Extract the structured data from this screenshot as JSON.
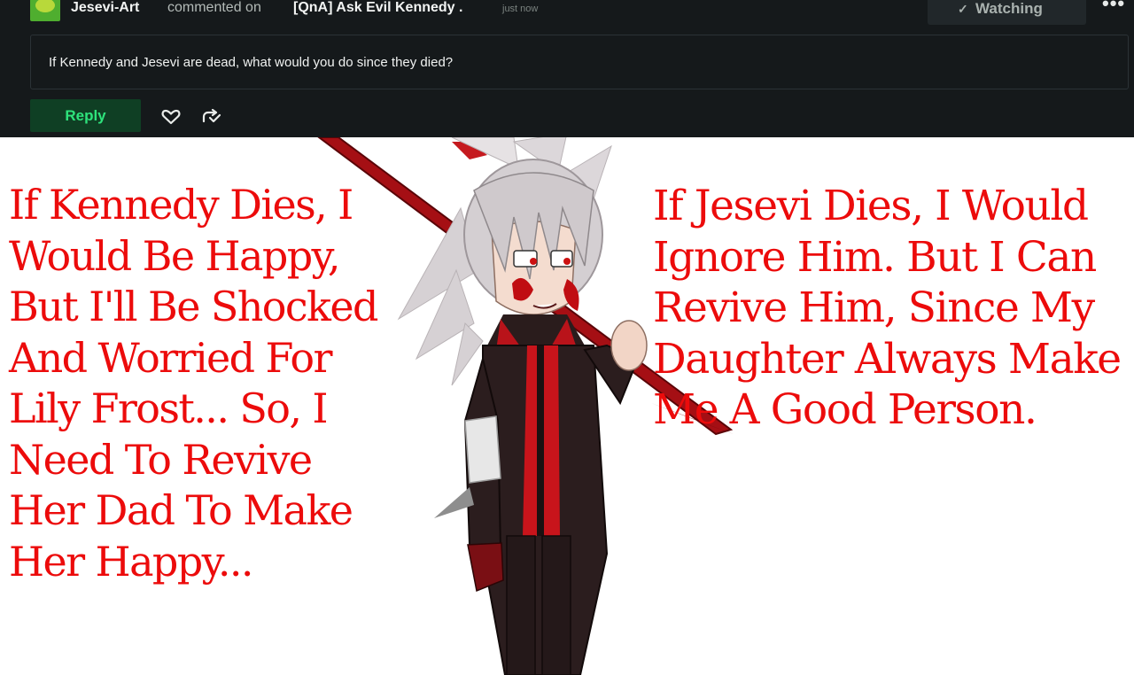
{
  "comment": {
    "author": "Jesevi-Art",
    "action": "commented on",
    "deviation_title": "[QnA] Ask Evil Kennedy .",
    "timestamp": "just now",
    "body": "If Kennedy and Jesevi are dead, what would you do since they died?"
  },
  "header_actions": {
    "watch_check": "✓",
    "watch_label": "Watching",
    "more_label": "•••"
  },
  "comment_actions": {
    "reply_label": "Reply",
    "icons": [
      "heart-icon",
      "share-icon"
    ]
  },
  "artwork": {
    "left_answer_lines": [
      "If Kennedy Dies, I",
      "Would Be Happy,",
      "But I'll Be Shocked",
      "And Worried For",
      "Lily Frost... So, I",
      "Need To Revive",
      "Her Dad To Make",
      "Her Happy..."
    ],
    "right_answer_lines": [
      "If Jesevi Dies, I Would",
      "Ignore Him. But I Can",
      "Revive Him, Since My",
      "Daughter Always Make",
      "Me A Good Person."
    ]
  },
  "colors": {
    "panel_bg": "#15191b",
    "reply_bg": "#0f3f24",
    "reply_text": "#2ee37c",
    "answer_text": "#ec0b0b"
  }
}
